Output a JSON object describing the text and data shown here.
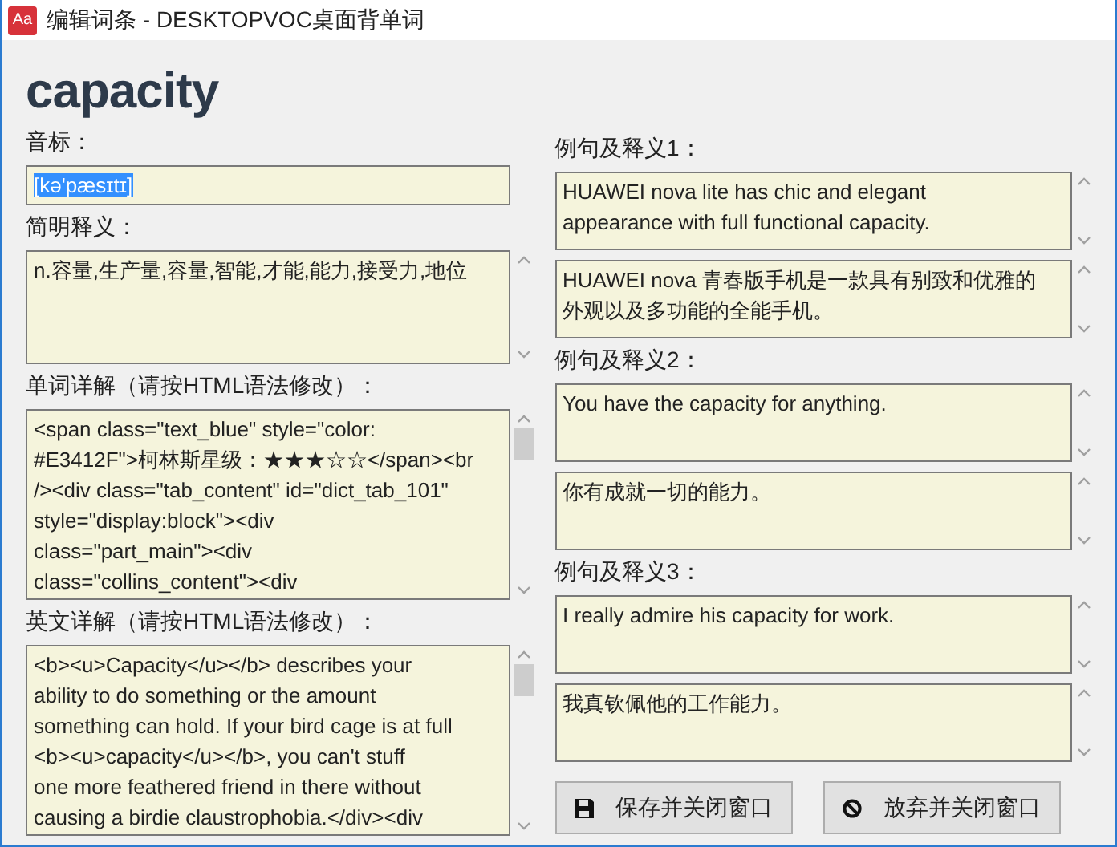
{
  "window": {
    "icon_text": "Aa",
    "title": "编辑词条 - DESKTOPVOC桌面背单词"
  },
  "word": "capacity",
  "left_fields": [
    {
      "label": "音标：",
      "kind": "line",
      "lines": [
        "[kə'pæsɪtɪ]"
      ],
      "text_selected": true,
      "scroll_thumb": false
    },
    {
      "label": "简明释义：",
      "kind": "area",
      "lines": [
        "n.容量,生产量,容量,智能,才能,能力,接受力,地位"
      ],
      "text_selected": false,
      "scroll_thumb": false
    },
    {
      "label": "单词详解（请按HTML语法修改）：",
      "kind": "code",
      "lines": [
        "<span class=\"text_blue\" style=\"color:",
        "#E3412F\">柯林斯星级：★★★☆☆</span><br",
        "/><div class=\"tab_content\" id=\"dict_tab_101\"",
        "style=\"display:block\"><div",
        "class=\"part_main\"><div",
        "class=\"collins_content\"><div"
      ],
      "text_selected": false,
      "scroll_thumb": true
    },
    {
      "label": "英文详解（请按HTML语法修改）：",
      "kind": "code",
      "lines": [
        "<b><u>Capacity</u></b> describes your",
        "ability to do something or the amount",
        "something can hold. If your bird cage is at full",
        "<b><u>capacity</u></b>, you can't stuff",
        "one more feathered friend in there without",
        "causing a birdie claustrophobia.</div><div"
      ],
      "text_selected": false,
      "scroll_thumb": true
    }
  ],
  "examples": [
    {
      "label": "例句及释义1：",
      "sentence": [
        "HUAWEI nova lite has chic and elegant",
        "appearance with full functional capacity."
      ],
      "translation": [
        "HUAWEI nova 青春版手机是一款具有别致和优雅的",
        "外观以及多功能的全能手机。"
      ]
    },
    {
      "label": "例句及释义2：",
      "sentence": [
        "You have the capacity for anything."
      ],
      "translation": [
        "你有成就一切的能力。"
      ]
    },
    {
      "label": "例句及释义3：",
      "sentence": [
        "I really admire his capacity for work."
      ],
      "translation": [
        "我真钦佩他的工作能力。"
      ]
    }
  ],
  "buttons": [
    {
      "kind": "save",
      "label": "保存并关闭窗口"
    },
    {
      "kind": "cancel",
      "label": "放弃并关闭窗口"
    }
  ]
}
